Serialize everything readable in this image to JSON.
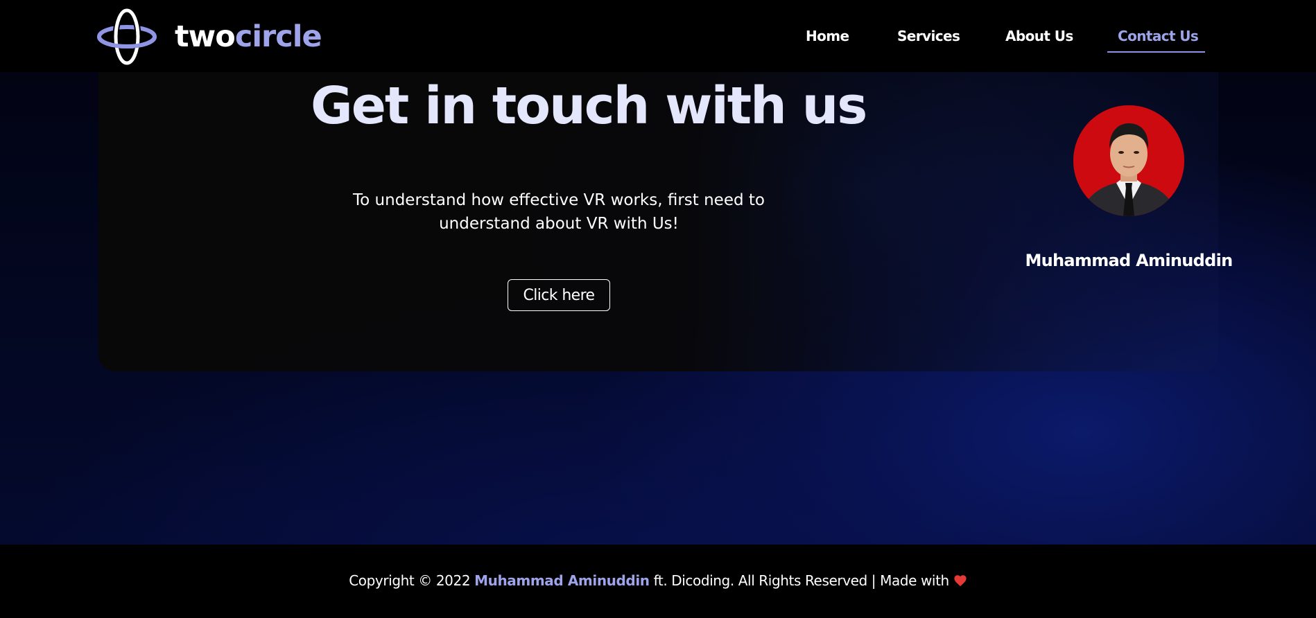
{
  "header": {
    "brand": {
      "part1": "two",
      "part2": "circle",
      "logo_icon": "orbit-logo-icon"
    },
    "nav": [
      {
        "label": "Home",
        "active": false
      },
      {
        "label": "Services",
        "active": false
      },
      {
        "label": "About Us",
        "active": false
      },
      {
        "label": "Contact Us",
        "active": true
      }
    ]
  },
  "hero": {
    "title": "Get in touch with us",
    "description": "To understand how effective VR works, first need to understand about VR with Us!",
    "button_label": "Click here"
  },
  "profile": {
    "name": "Muhammad Aminuddin",
    "photo_icon": "profile-photo"
  },
  "footer": {
    "prefix": "Copyright © 2022 ",
    "author": "Muhammad Aminuddin",
    "suffix": " ft. Dicoding. All Rights Reserved | Made with",
    "icon": "heart-icon"
  },
  "colors": {
    "accent": "#9ea4ea",
    "background": "#000000",
    "hero_glow": "#0b1a6a",
    "heart": "#e53935",
    "photo_background": "#cc0a10"
  }
}
